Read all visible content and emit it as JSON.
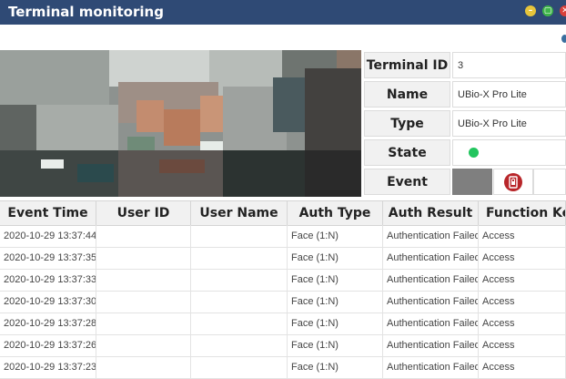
{
  "window": {
    "title": "Terminal monitoring",
    "minimize_glyph": "–",
    "maximize_glyph": "▢",
    "close_glyph": "✕",
    "colors": {
      "titlebar": "#2f4a75",
      "minimize": "#e7c53b",
      "maximize": "#3fb54a",
      "close": "#d9403a"
    }
  },
  "terminal": {
    "id_label": "Terminal ID",
    "id_value": "3",
    "name_label": "Name",
    "name_value": "UBio-X Pro Lite",
    "type_label": "Type",
    "type_value": "UBio-X Pro Lite",
    "state_label": "State",
    "state_color": "#22c55e",
    "event_label": "Event",
    "event_icon": "phone-lock-icon"
  },
  "table": {
    "headers": [
      "Event Time",
      "User ID",
      "User Name",
      "Auth Type",
      "Auth Result",
      "Function Key"
    ],
    "rows": [
      [
        "2020-10-29 13:37:44",
        "",
        "",
        "Face (1:N)",
        "Authentication Failed",
        "Access"
      ],
      [
        "2020-10-29 13:37:35",
        "",
        "",
        "Face (1:N)",
        "Authentication Failed",
        "Access"
      ],
      [
        "2020-10-29 13:37:33",
        "",
        "",
        "Face (1:N)",
        "Authentication Failed",
        "Access"
      ],
      [
        "2020-10-29 13:37:30",
        "",
        "",
        "Face (1:N)",
        "Authentication Failed",
        "Access"
      ],
      [
        "2020-10-29 13:37:28",
        "",
        "",
        "Face (1:N)",
        "Authentication Failed",
        "Access"
      ],
      [
        "2020-10-29 13:37:26",
        "",
        "",
        "Face (1:N)",
        "Authentication Failed",
        "Access"
      ],
      [
        "2020-10-29 13:37:23",
        "",
        "",
        "Face (1:N)",
        "Authentication Failed",
        "Access"
      ]
    ]
  }
}
